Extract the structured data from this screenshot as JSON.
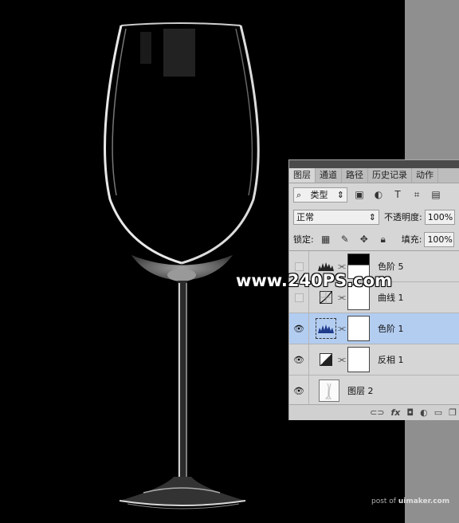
{
  "watermark": "www.240PS.com",
  "credit_prefix": "post of ",
  "credit_brand": "uimaker.com",
  "panel": {
    "tabs": [
      "图层",
      "通道",
      "路径",
      "历史记录",
      "动作"
    ],
    "filter_label": "类型",
    "blend_mode": "正常",
    "opacity_label": "不透明度:",
    "opacity_value": "100%",
    "lock_label": "锁定:",
    "fill_label": "填充:",
    "fill_value": "100%",
    "layers": [
      {
        "name": "色阶 5",
        "visible": false,
        "type": "levels-icon",
        "mask": "black-top"
      },
      {
        "name": "曲线 1",
        "visible": false,
        "type": "curves-icon",
        "mask": "white"
      },
      {
        "name": "色阶 1",
        "visible": true,
        "type": "levels-icon",
        "mask": "white",
        "selected": true
      },
      {
        "name": "反相 1",
        "visible": true,
        "type": "invert-icon",
        "mask": "white"
      },
      {
        "name": "图层 2",
        "visible": true,
        "type": "pixel-layer",
        "mask": "none"
      }
    ],
    "bottom": {
      "link": "⊂⊃",
      "fx": "fx",
      "mask": "◘",
      "adj": "◐",
      "group": "▭",
      "new": "❐"
    }
  },
  "colors": {
    "selected": "#b3cdf1",
    "canvas": "#000000",
    "panel": "#d6d6d6"
  }
}
